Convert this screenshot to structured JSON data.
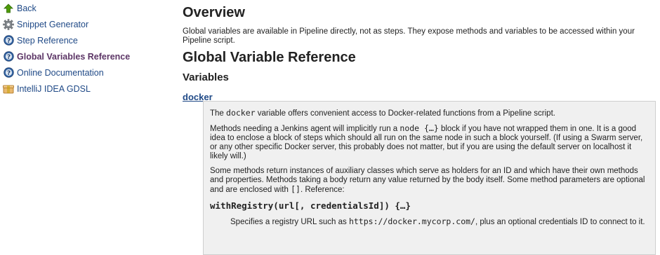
{
  "sidebar": {
    "items": [
      {
        "label": "Back",
        "icon": "up-arrow-icon",
        "active": false
      },
      {
        "label": "Snippet Generator",
        "icon": "gear-icon",
        "active": false
      },
      {
        "label": "Step Reference",
        "icon": "help-icon",
        "active": false
      },
      {
        "label": "Global Variables Reference",
        "icon": "help-icon",
        "active": true
      },
      {
        "label": "Online Documentation",
        "icon": "help-icon",
        "active": false
      },
      {
        "label": "IntelliJ IDEA GDSL",
        "icon": "package-icon",
        "active": false
      }
    ]
  },
  "main": {
    "overview_heading": "Overview",
    "overview_text": "Global variables are available in Pipeline directly, not as steps. They expose methods and variables to be accessed within your Pipeline script.",
    "global_heading": "Global Variable Reference",
    "variables_heading": "Variables",
    "variable_link": "docker",
    "doc": {
      "p1_pre": "The ",
      "p1_code": "docker",
      "p1_post": " variable offers convenient access to Docker-related functions from a Pipeline script.",
      "p2_pre": "Methods needing a Jenkins agent will implicitly run a ",
      "p2_code": "node {…}",
      "p2_post": " block if you have not wrapped them in one. It is a good idea to enclose a block of steps which should all run on the same node in such a block yourself. (If using a Swarm server, or any other specific Docker server, this probably does not matter, but if you are using the default server on localhost it likely will.)",
      "p3_pre": "Some methods return instances of auxiliary classes which serve as holders for an ID and which have their own methods and properties. Methods taking a body return any value returned by the body itself. Some method parameters are optional and are enclosed with ",
      "p3_code": "[]",
      "p3_post": ". Reference:",
      "method_signature": "withRegistry(url[, credentialsId]) {…}",
      "method_desc_pre": "Specifies a registry URL such as ",
      "method_desc_code": "https://docker.mycorp.com/",
      "method_desc_post": ", plus an optional credentials ID to connect to it."
    }
  },
  "colors": {
    "link": "#204a87",
    "active_link": "#5c3566",
    "doc_box_bg": "#f0f0f0",
    "doc_box_border": "#cfcfcf"
  }
}
